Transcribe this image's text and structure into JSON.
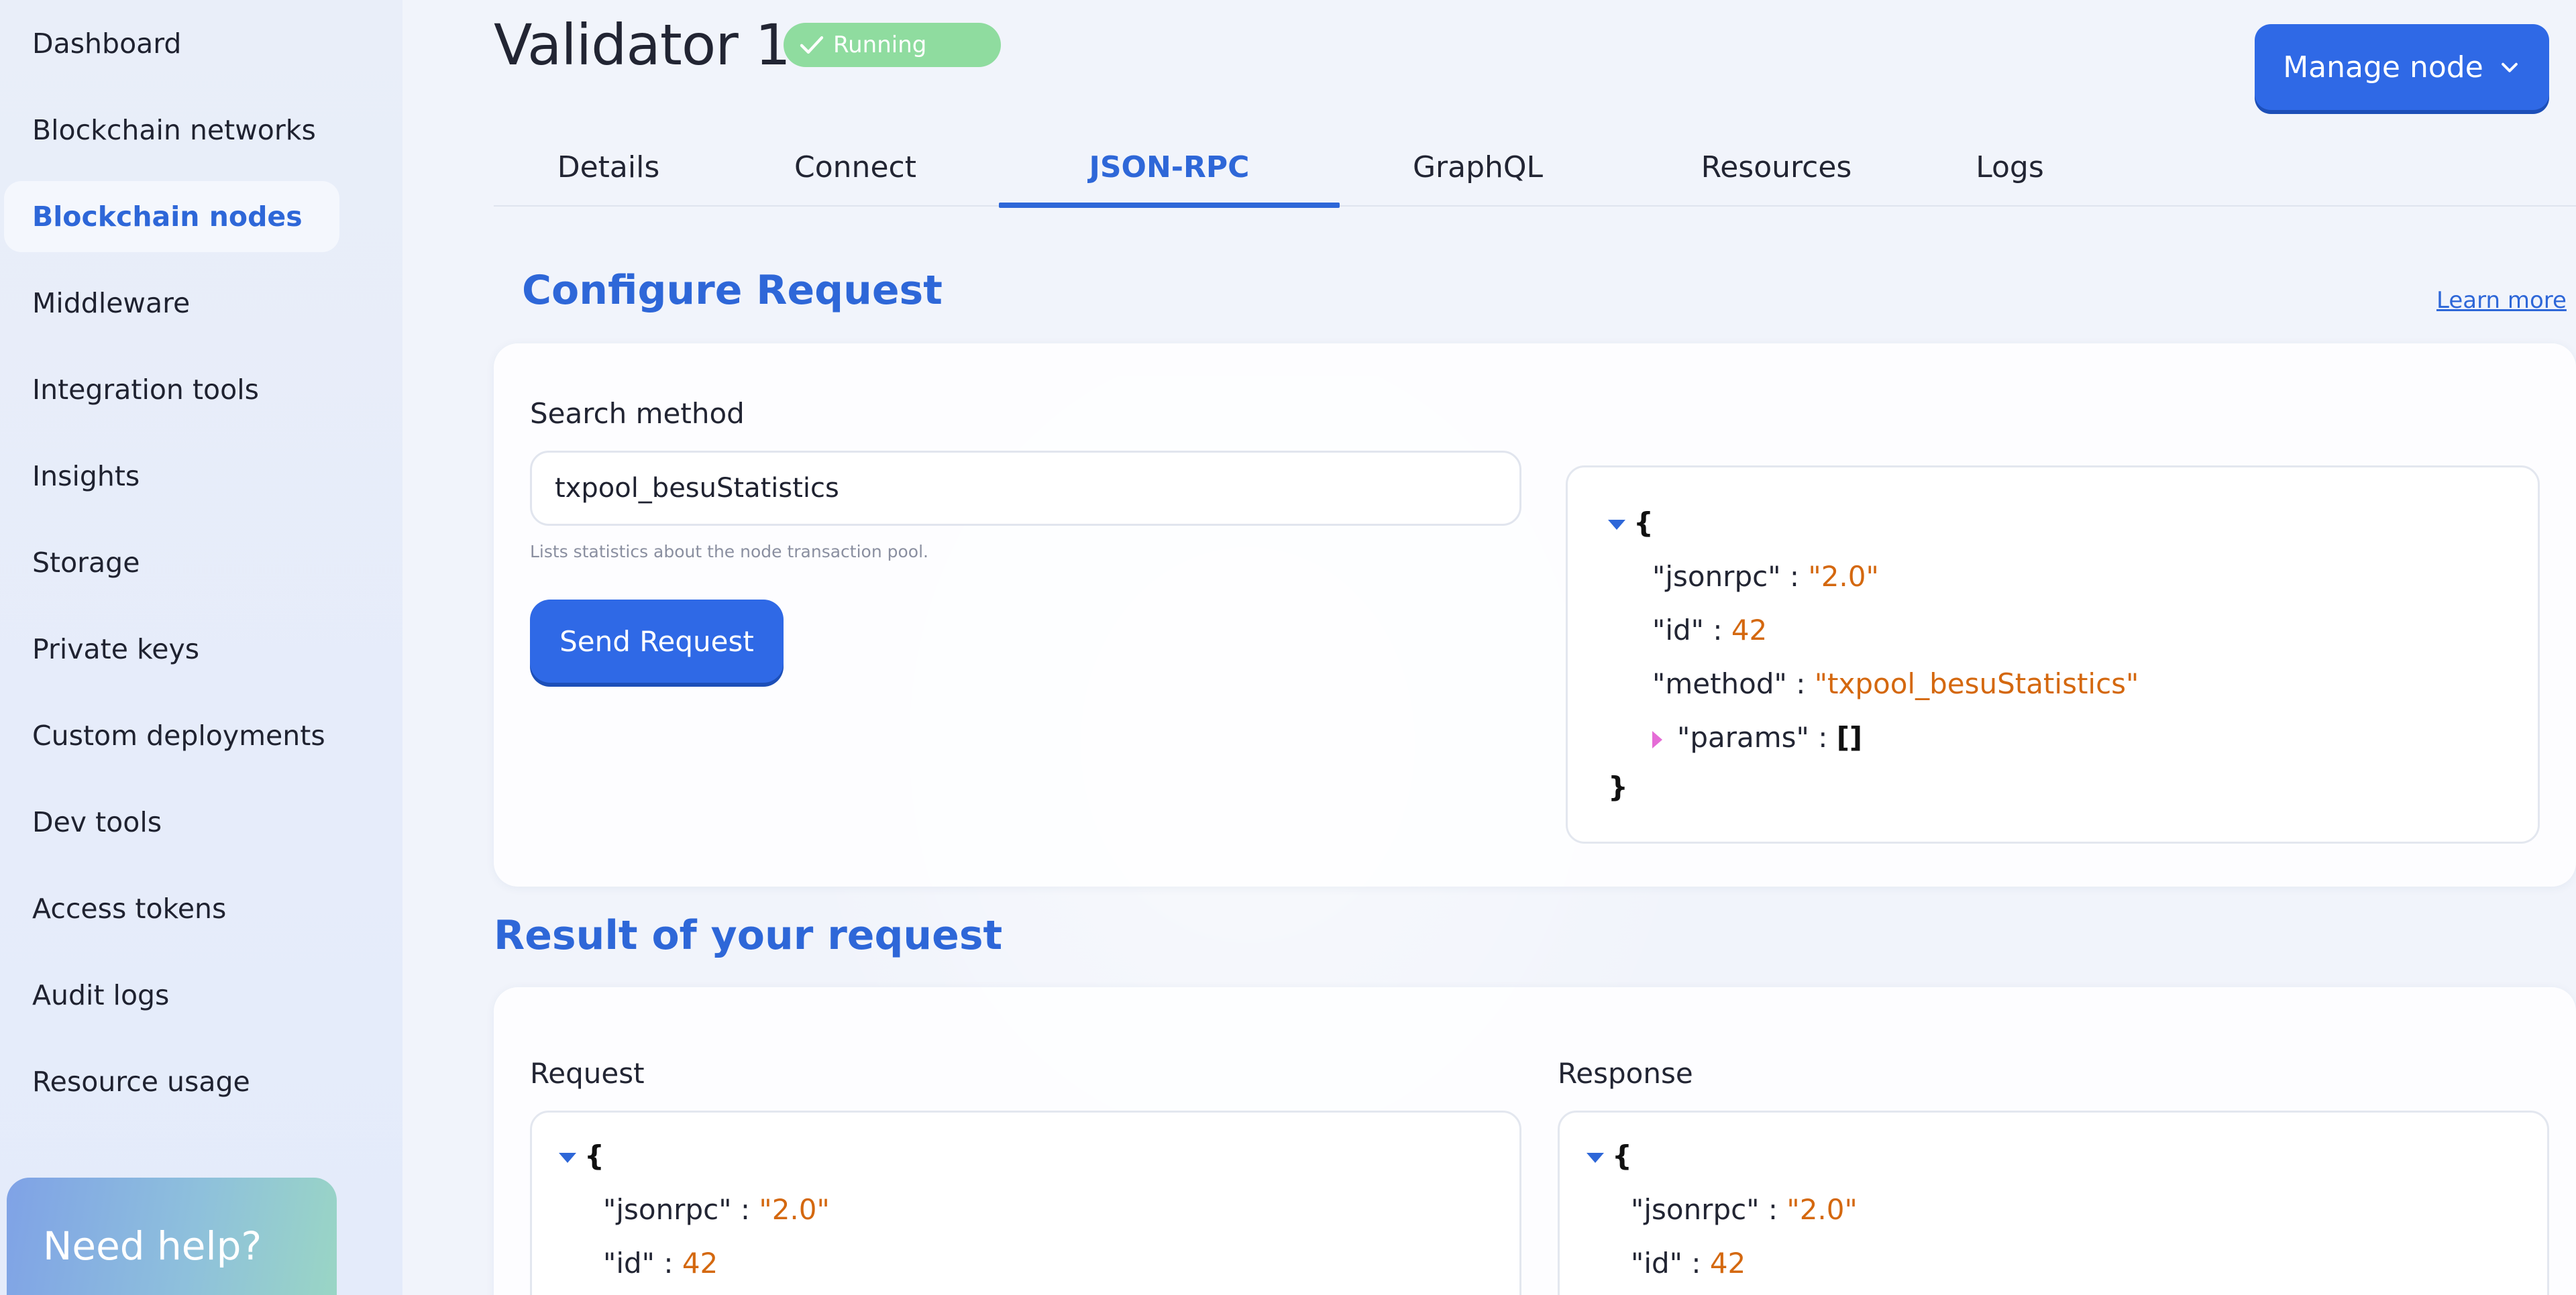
{
  "sidebar": {
    "items": [
      {
        "label": "Dashboard",
        "active": false
      },
      {
        "label": "Blockchain networks",
        "active": false
      },
      {
        "label": "Blockchain nodes",
        "active": true
      },
      {
        "label": "Middleware",
        "active": false
      },
      {
        "label": "Integration tools",
        "active": false
      },
      {
        "label": "Insights",
        "active": false
      },
      {
        "label": "Storage",
        "active": false
      },
      {
        "label": "Private keys",
        "active": false
      },
      {
        "label": "Custom deployments",
        "active": false
      },
      {
        "label": "Dev tools",
        "active": false
      },
      {
        "label": "Access tokens",
        "active": false
      },
      {
        "label": "Audit logs",
        "active": false
      },
      {
        "label": "Resource usage",
        "active": false
      }
    ],
    "help_label": "Need help?"
  },
  "header": {
    "title": "Validator 1",
    "status": "Running",
    "status_icon": "check-icon",
    "manage_label": "Manage node"
  },
  "tabs": [
    {
      "label": "Details",
      "active": false
    },
    {
      "label": "Connect",
      "active": false
    },
    {
      "label": "JSON-RPC",
      "active": true
    },
    {
      "label": "GraphQL",
      "active": false
    },
    {
      "label": "Resources",
      "active": false
    },
    {
      "label": "Logs",
      "active": false
    }
  ],
  "configure": {
    "title": "Configure Request",
    "learn_more": "Learn more",
    "search_label": "Search method",
    "search_value": "txpool_besuStatistics",
    "hint": "Lists statistics about the node transaction pool.",
    "send_label": "Send Request",
    "preview": {
      "open": "{",
      "close": "}",
      "lines": [
        {
          "key": "\"jsonrpc\"",
          "sep": " : ",
          "value": "\"2.0\""
        },
        {
          "key": "\"id\"",
          "sep": " : ",
          "value": "42"
        },
        {
          "key": "\"method\"",
          "sep": " : ",
          "value": "\"txpool_besuStatistics\""
        }
      ],
      "params_key": "\"params\"",
      "params_sep": " : ",
      "params_value": "[]"
    }
  },
  "result": {
    "title": "Result of your request",
    "request_label": "Request",
    "response_label": "Response",
    "request": {
      "open": "{",
      "lines": [
        {
          "key": "\"jsonrpc\"",
          "sep": " : ",
          "value": "\"2.0\""
        },
        {
          "key": "\"id\"",
          "sep": " : ",
          "value": "42"
        }
      ]
    },
    "response": {
      "open": "{",
      "lines": [
        {
          "key": "\"jsonrpc\"",
          "sep": " : ",
          "value": "\"2.0\""
        },
        {
          "key": "\"id\"",
          "sep": " : ",
          "value": "42"
        }
      ]
    }
  },
  "colors": {
    "accent": "#2e67d8",
    "button": "#2f69e6",
    "status": "#8fdc9f",
    "json_value": "#d4680f"
  }
}
